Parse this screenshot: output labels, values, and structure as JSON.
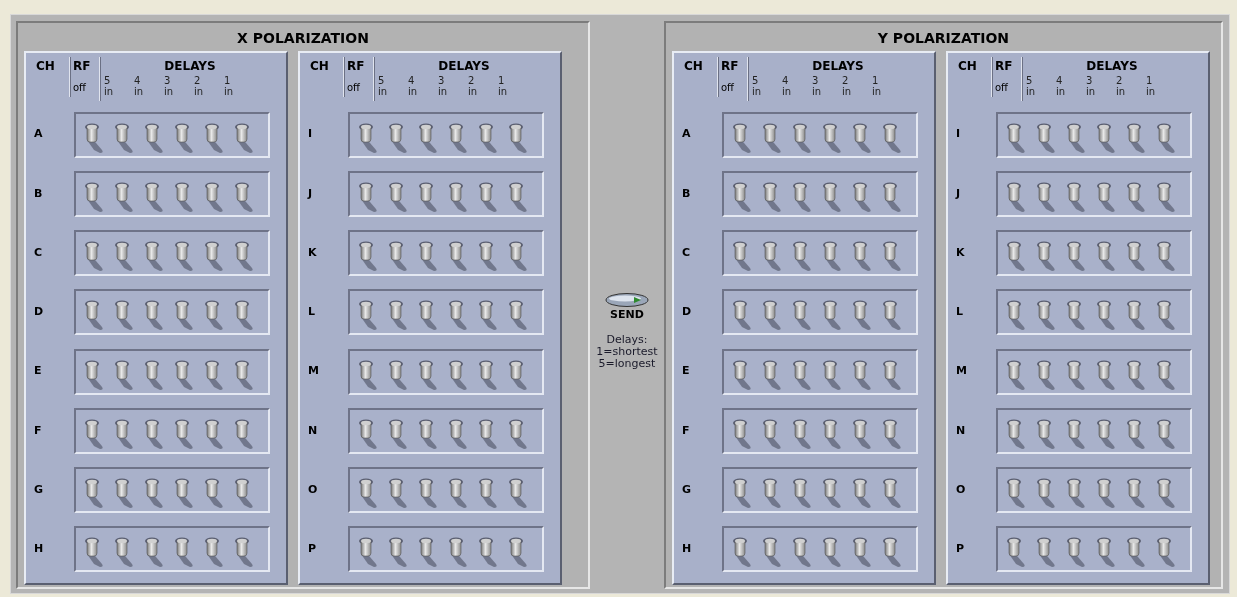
{
  "polarizations": [
    {
      "title": "X POLARIZATION",
      "groups": [
        {
          "ch_header": "CH",
          "rf_header": "RF",
          "delays_header": "DELAYS",
          "off_label": "off",
          "delay_labels": [
            {
              "number": "5",
              "unit": "in"
            },
            {
              "number": "4",
              "unit": "in"
            },
            {
              "number": "3",
              "unit": "in"
            },
            {
              "number": "2",
              "unit": "in"
            },
            {
              "number": "1",
              "unit": "in"
            }
          ],
          "channels": [
            {
              "label": "A",
              "switches": [
                {
                  "on": false
                },
                {
                  "on": false
                },
                {
                  "on": false
                },
                {
                  "on": false
                },
                {
                  "on": false
                },
                {
                  "on": false
                }
              ]
            },
            {
              "label": "B",
              "switches": [
                {
                  "on": false
                },
                {
                  "on": false
                },
                {
                  "on": false
                },
                {
                  "on": false
                },
                {
                  "on": false
                },
                {
                  "on": false
                }
              ]
            },
            {
              "label": "C",
              "switches": [
                {
                  "on": false
                },
                {
                  "on": false
                },
                {
                  "on": false
                },
                {
                  "on": false
                },
                {
                  "on": false
                },
                {
                  "on": false
                }
              ]
            },
            {
              "label": "D",
              "switches": [
                {
                  "on": false
                },
                {
                  "on": false
                },
                {
                  "on": false
                },
                {
                  "on": false
                },
                {
                  "on": false
                },
                {
                  "on": false
                }
              ]
            },
            {
              "label": "E",
              "switches": [
                {
                  "on": false
                },
                {
                  "on": false
                },
                {
                  "on": false
                },
                {
                  "on": false
                },
                {
                  "on": false
                },
                {
                  "on": false
                }
              ]
            },
            {
              "label": "F",
              "switches": [
                {
                  "on": false
                },
                {
                  "on": false
                },
                {
                  "on": false
                },
                {
                  "on": false
                },
                {
                  "on": false
                },
                {
                  "on": false
                }
              ]
            },
            {
              "label": "G",
              "switches": [
                {
                  "on": false
                },
                {
                  "on": false
                },
                {
                  "on": false
                },
                {
                  "on": false
                },
                {
                  "on": false
                },
                {
                  "on": false
                }
              ]
            },
            {
              "label": "H",
              "switches": [
                {
                  "on": false
                },
                {
                  "on": false
                },
                {
                  "on": false
                },
                {
                  "on": false
                },
                {
                  "on": false
                },
                {
                  "on": false
                }
              ]
            }
          ]
        },
        {
          "ch_header": "CH",
          "rf_header": "RF",
          "delays_header": "DELAYS",
          "off_label": "off",
          "delay_labels": [
            {
              "number": "5",
              "unit": "in"
            },
            {
              "number": "4",
              "unit": "in"
            },
            {
              "number": "3",
              "unit": "in"
            },
            {
              "number": "2",
              "unit": "in"
            },
            {
              "number": "1",
              "unit": "in"
            }
          ],
          "channels": [
            {
              "label": "I",
              "switches": [
                {
                  "on": false
                },
                {
                  "on": false
                },
                {
                  "on": false
                },
                {
                  "on": false
                },
                {
                  "on": false
                },
                {
                  "on": false
                }
              ]
            },
            {
              "label": "J",
              "switches": [
                {
                  "on": false
                },
                {
                  "on": false
                },
                {
                  "on": false
                },
                {
                  "on": false
                },
                {
                  "on": false
                },
                {
                  "on": false
                }
              ]
            },
            {
              "label": "K",
              "switches": [
                {
                  "on": false
                },
                {
                  "on": false
                },
                {
                  "on": false
                },
                {
                  "on": false
                },
                {
                  "on": false
                },
                {
                  "on": false
                }
              ]
            },
            {
              "label": "L",
              "switches": [
                {
                  "on": false
                },
                {
                  "on": false
                },
                {
                  "on": false
                },
                {
                  "on": false
                },
                {
                  "on": false
                },
                {
                  "on": false
                }
              ]
            },
            {
              "label": "M",
              "switches": [
                {
                  "on": false
                },
                {
                  "on": false
                },
                {
                  "on": false
                },
                {
                  "on": false
                },
                {
                  "on": false
                },
                {
                  "on": false
                }
              ]
            },
            {
              "label": "N",
              "switches": [
                {
                  "on": false
                },
                {
                  "on": false
                },
                {
                  "on": false
                },
                {
                  "on": false
                },
                {
                  "on": false
                },
                {
                  "on": false
                }
              ]
            },
            {
              "label": "O",
              "switches": [
                {
                  "on": false
                },
                {
                  "on": false
                },
                {
                  "on": false
                },
                {
                  "on": false
                },
                {
                  "on": false
                },
                {
                  "on": false
                }
              ]
            },
            {
              "label": "P",
              "switches": [
                {
                  "on": false
                },
                {
                  "on": false
                },
                {
                  "on": false
                },
                {
                  "on": false
                },
                {
                  "on": false
                },
                {
                  "on": false
                }
              ]
            }
          ]
        }
      ]
    },
    {
      "title": "Y POLARIZATION",
      "groups": [
        {
          "ch_header": "CH",
          "rf_header": "RF",
          "delays_header": "DELAYS",
          "off_label": "off",
          "delay_labels": [
            {
              "number": "5",
              "unit": "in"
            },
            {
              "number": "4",
              "unit": "in"
            },
            {
              "number": "3",
              "unit": "in"
            },
            {
              "number": "2",
              "unit": "in"
            },
            {
              "number": "1",
              "unit": "in"
            }
          ],
          "channels": [
            {
              "label": "A",
              "switches": [
                {
                  "on": false
                },
                {
                  "on": false
                },
                {
                  "on": false
                },
                {
                  "on": false
                },
                {
                  "on": false
                },
                {
                  "on": false
                }
              ]
            },
            {
              "label": "B",
              "switches": [
                {
                  "on": false
                },
                {
                  "on": false
                },
                {
                  "on": false
                },
                {
                  "on": false
                },
                {
                  "on": false
                },
                {
                  "on": false
                }
              ]
            },
            {
              "label": "C",
              "switches": [
                {
                  "on": false
                },
                {
                  "on": false
                },
                {
                  "on": false
                },
                {
                  "on": false
                },
                {
                  "on": false
                },
                {
                  "on": false
                }
              ]
            },
            {
              "label": "D",
              "switches": [
                {
                  "on": false
                },
                {
                  "on": false
                },
                {
                  "on": false
                },
                {
                  "on": false
                },
                {
                  "on": false
                },
                {
                  "on": false
                }
              ]
            },
            {
              "label": "E",
              "switches": [
                {
                  "on": false
                },
                {
                  "on": false
                },
                {
                  "on": false
                },
                {
                  "on": false
                },
                {
                  "on": false
                },
                {
                  "on": false
                }
              ]
            },
            {
              "label": "F",
              "switches": [
                {
                  "on": false
                },
                {
                  "on": false
                },
                {
                  "on": false
                },
                {
                  "on": false
                },
                {
                  "on": false
                },
                {
                  "on": false
                }
              ]
            },
            {
              "label": "G",
              "switches": [
                {
                  "on": false
                },
                {
                  "on": false
                },
                {
                  "on": false
                },
                {
                  "on": false
                },
                {
                  "on": false
                },
                {
                  "on": false
                }
              ]
            },
            {
              "label": "H",
              "switches": [
                {
                  "on": false
                },
                {
                  "on": false
                },
                {
                  "on": false
                },
                {
                  "on": false
                },
                {
                  "on": false
                },
                {
                  "on": false
                }
              ]
            }
          ]
        },
        {
          "ch_header": "CH",
          "rf_header": "RF",
          "delays_header": "DELAYS",
          "off_label": "off",
          "delay_labels": [
            {
              "number": "5",
              "unit": "in"
            },
            {
              "number": "4",
              "unit": "in"
            },
            {
              "number": "3",
              "unit": "in"
            },
            {
              "number": "2",
              "unit": "in"
            },
            {
              "number": "1",
              "unit": "in"
            }
          ],
          "channels": [
            {
              "label": "I",
              "switches": [
                {
                  "on": false
                },
                {
                  "on": false
                },
                {
                  "on": false
                },
                {
                  "on": false
                },
                {
                  "on": false
                },
                {
                  "on": false
                }
              ]
            },
            {
              "label": "J",
              "switches": [
                {
                  "on": false
                },
                {
                  "on": false
                },
                {
                  "on": false
                },
                {
                  "on": false
                },
                {
                  "on": false
                },
                {
                  "on": false
                }
              ]
            },
            {
              "label": "K",
              "switches": [
                {
                  "on": false
                },
                {
                  "on": false
                },
                {
                  "on": false
                },
                {
                  "on": false
                },
                {
                  "on": false
                },
                {
                  "on": false
                }
              ]
            },
            {
              "label": "L",
              "switches": [
                {
                  "on": false
                },
                {
                  "on": false
                },
                {
                  "on": false
                },
                {
                  "on": false
                },
                {
                  "on": false
                },
                {
                  "on": false
                }
              ]
            },
            {
              "label": "M",
              "switches": [
                {
                  "on": false
                },
                {
                  "on": false
                },
                {
                  "on": false
                },
                {
                  "on": false
                },
                {
                  "on": false
                },
                {
                  "on": false
                }
              ]
            },
            {
              "label": "N",
              "switches": [
                {
                  "on": false
                },
                {
                  "on": false
                },
                {
                  "on": false
                },
                {
                  "on": false
                },
                {
                  "on": false
                },
                {
                  "on": false
                }
              ]
            },
            {
              "label": "O",
              "switches": [
                {
                  "on": false
                },
                {
                  "on": false
                },
                {
                  "on": false
                },
                {
                  "on": false
                },
                {
                  "on": false
                },
                {
                  "on": false
                }
              ]
            },
            {
              "label": "P",
              "switches": [
                {
                  "on": false
                },
                {
                  "on": false
                },
                {
                  "on": false
                },
                {
                  "on": false
                },
                {
                  "on": false
                },
                {
                  "on": false
                }
              ]
            }
          ]
        }
      ]
    }
  ],
  "send": {
    "label": "SEND"
  },
  "note": [
    "Delays:",
    "1=shortest",
    "5=longest"
  ]
}
